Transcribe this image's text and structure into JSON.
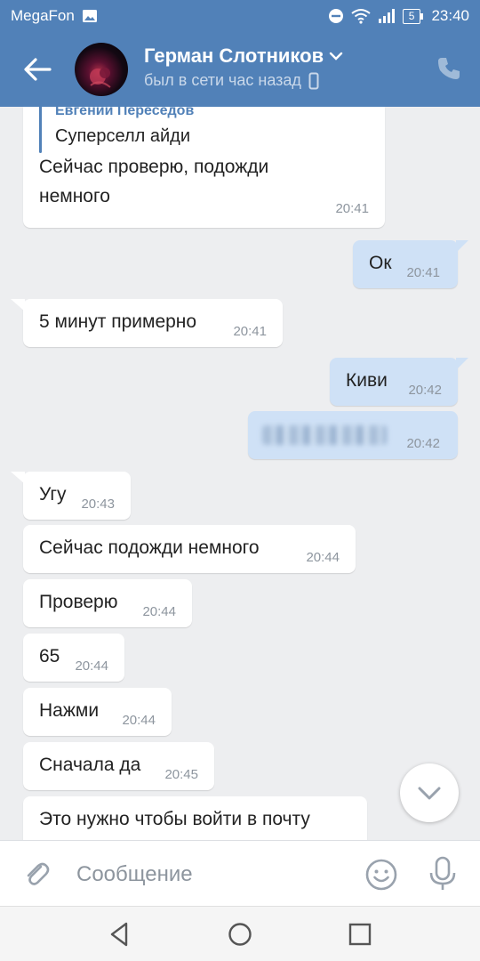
{
  "status_bar": {
    "carrier": "MegaFon",
    "battery": "5",
    "time": "23:40",
    "icons": [
      "image-icon",
      "do-not-disturb-icon",
      "wifi-icon",
      "signal-icon",
      "battery-icon"
    ]
  },
  "header": {
    "name": "Герман Слотников",
    "status": "был в сети час назад"
  },
  "messages": [
    {
      "dir": "in",
      "reply_author": "Евгений Переседов",
      "reply_text": "Суперселл айди",
      "line1": "Сейчас проверю, подожди",
      "line2": "немного",
      "time": "20:41"
    },
    {
      "dir": "out",
      "text": "Ок",
      "time": "20:41"
    },
    {
      "dir": "in",
      "text": "5 минут примерно",
      "time": "20:41"
    },
    {
      "dir": "out",
      "text": "Киви",
      "time": "20:42"
    },
    {
      "dir": "out",
      "text": "",
      "time": "20:42",
      "blurred": true
    },
    {
      "dir": "in",
      "text": "Угу",
      "time": "20:43"
    },
    {
      "dir": "in",
      "text": "Сейчас подожди немного",
      "time": "20:44"
    },
    {
      "dir": "in",
      "text": "Проверю",
      "time": "20:44"
    },
    {
      "dir": "in",
      "text": "65",
      "time": "20:44"
    },
    {
      "dir": "in",
      "text": "Нажми",
      "time": "20:44"
    },
    {
      "dir": "in",
      "text": "Сначала да",
      "time": "20:45"
    },
    {
      "dir": "in",
      "text": "Это нужно чтобы войти в почту",
      "time": ""
    }
  ],
  "composer": {
    "placeholder": "Сообщение"
  },
  "colors": {
    "header_bg": "#5181b8",
    "chat_bg": "#edeef0",
    "bubble_in": "#ffffff",
    "bubble_out": "#cfe1f6",
    "accent": "#5181b8"
  }
}
